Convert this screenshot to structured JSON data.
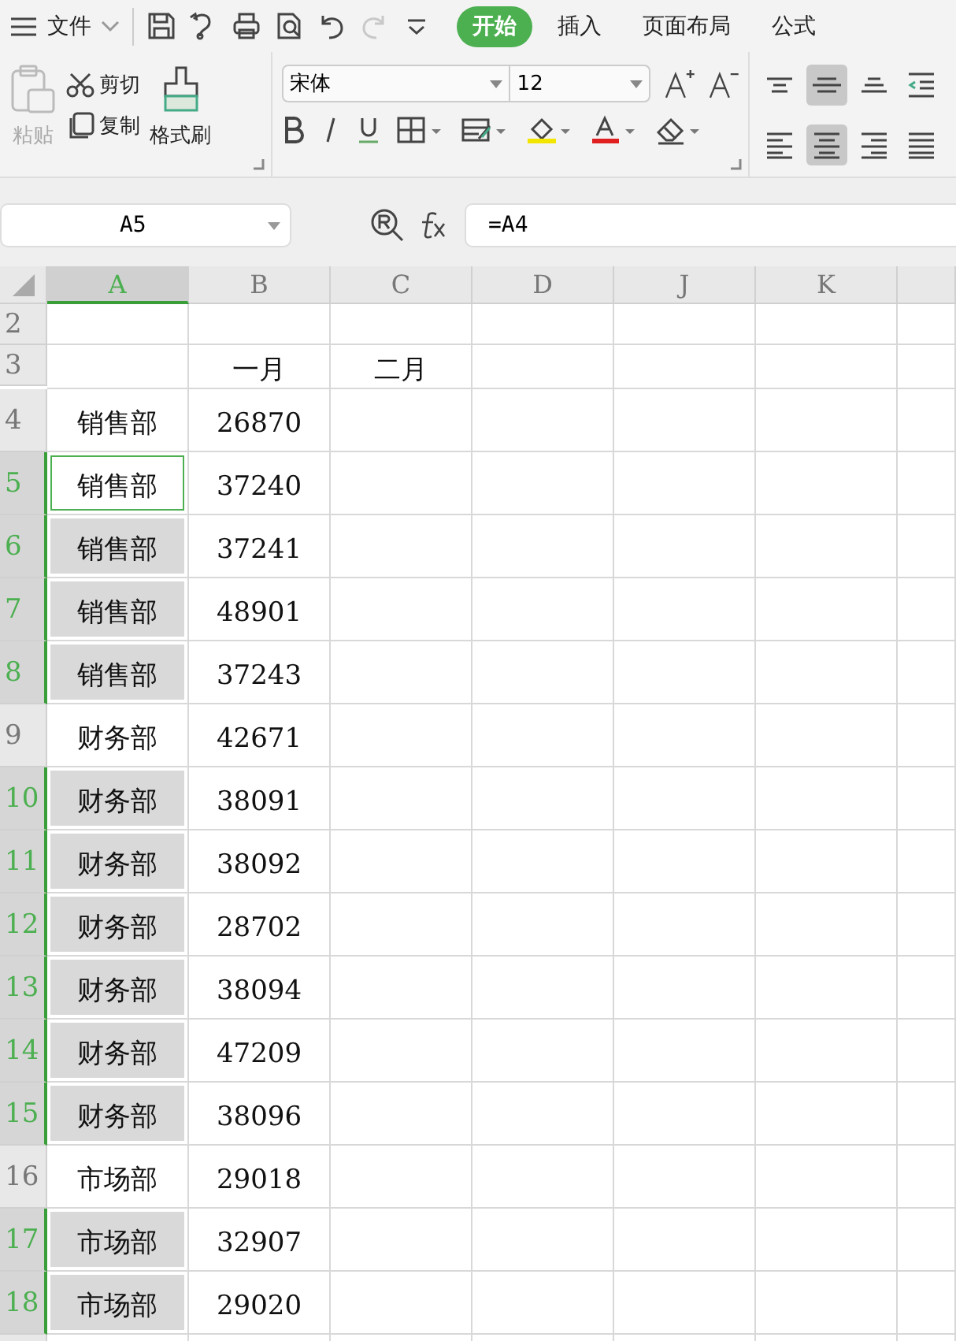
{
  "menu_bar": {
    "file_menu": "文件",
    "quick_access": [
      {
        "kind": "save",
        "disabled": false
      },
      {
        "kind": "curl",
        "disabled": false
      },
      {
        "kind": "print",
        "disabled": false
      },
      {
        "kind": "preview",
        "disabled": false
      },
      {
        "kind": "undo",
        "disabled": false
      },
      {
        "kind": "redo",
        "disabled": true
      },
      {
        "kind": "more",
        "disabled": false
      }
    ],
    "tabs": [
      {
        "label": "开始",
        "selected": true
      },
      {
        "label": "插入",
        "selected": false
      },
      {
        "label": "页面布局",
        "selected": false
      },
      {
        "label": "公式",
        "selected": false
      }
    ]
  },
  "ribbon": {
    "clipboard": {
      "paste": {
        "label": "粘贴",
        "disabled": true
      },
      "cut": "剪切",
      "copy": "复制",
      "format_painter": "格式刷"
    },
    "font": {
      "name": "宋体",
      "size": "12"
    },
    "alignment": [
      {
        "kind": "top",
        "selected": false
      },
      {
        "kind": "middle",
        "selected": true
      },
      {
        "kind": "bottom",
        "selected": false
      },
      {
        "kind": "outdent",
        "selected": false
      },
      {
        "kind": "left",
        "selected": false
      },
      {
        "kind": "center",
        "selected": true
      },
      {
        "kind": "right",
        "selected": false
      },
      {
        "kind": "justify",
        "selected": false
      }
    ]
  },
  "name_box": "A5",
  "formula": "=A4",
  "columns": [
    {
      "label": "A",
      "selected": true
    },
    {
      "label": "B",
      "selected": false
    },
    {
      "label": "C",
      "selected": false
    },
    {
      "label": "D",
      "selected": false
    },
    {
      "label": "J",
      "selected": false
    },
    {
      "label": "K",
      "selected": false
    }
  ],
  "rows": [
    {
      "number": "2",
      "selected": false
    },
    {
      "number": "3",
      "selected": false,
      "b": "一月",
      "c": "二月"
    },
    {
      "number": "4",
      "selected": false,
      "active": false,
      "a": "销售部",
      "b": "26870"
    },
    {
      "number": "5",
      "selected": true,
      "active": true,
      "a": "销售部",
      "b": "37240"
    },
    {
      "number": "6",
      "selected": true,
      "active": false,
      "a": "销售部",
      "b": "37241"
    },
    {
      "number": "7",
      "selected": true,
      "active": false,
      "a": "销售部",
      "b": "48901"
    },
    {
      "number": "8",
      "selected": true,
      "active": false,
      "a": "销售部",
      "b": "37243"
    },
    {
      "number": "9",
      "selected": false,
      "active": false,
      "a": "财务部",
      "b": "42671"
    },
    {
      "number": "10",
      "selected": true,
      "active": false,
      "a": "财务部",
      "b": "38091"
    },
    {
      "number": "11",
      "selected": true,
      "active": false,
      "a": "财务部",
      "b": "38092"
    },
    {
      "number": "12",
      "selected": true,
      "active": false,
      "a": "财务部",
      "b": "28702"
    },
    {
      "number": "13",
      "selected": true,
      "active": false,
      "a": "财务部",
      "b": "38094"
    },
    {
      "number": "14",
      "selected": true,
      "active": false,
      "a": "财务部",
      "b": "47209"
    },
    {
      "number": "15",
      "selected": true,
      "active": false,
      "a": "财务部",
      "b": "38096"
    },
    {
      "number": "16",
      "selected": false,
      "active": false,
      "a": "市场部",
      "b": "29018"
    },
    {
      "number": "17",
      "selected": true,
      "active": false,
      "a": "市场部",
      "b": "32907"
    },
    {
      "number": "18",
      "selected": true,
      "active": false,
      "a": "市场部",
      "b": "29020"
    }
  ]
}
